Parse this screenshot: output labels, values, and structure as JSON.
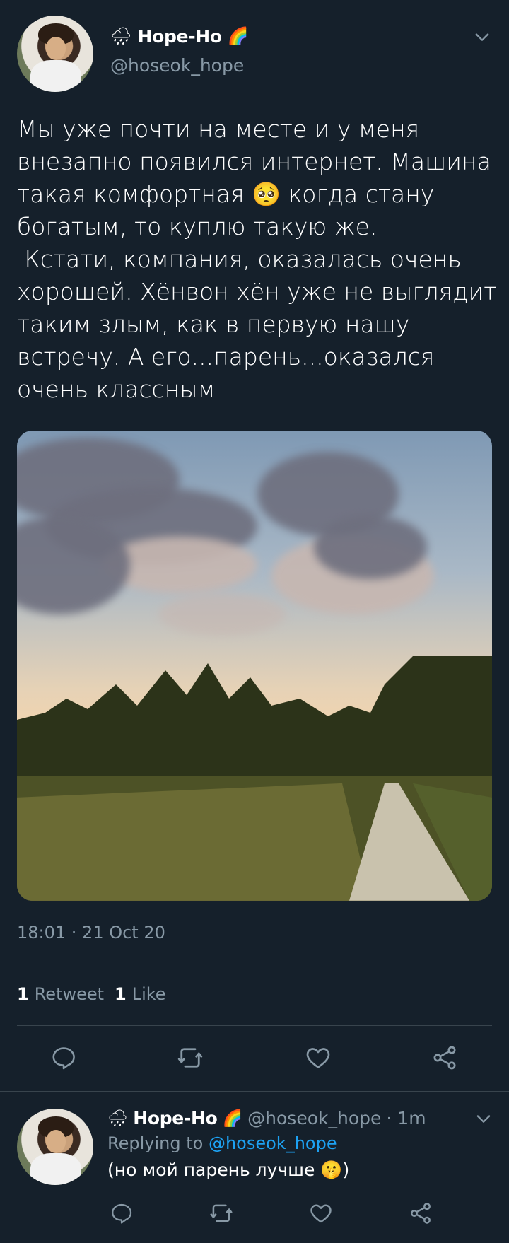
{
  "tweet": {
    "prefix_emoji": "🌧",
    "display_name": "Hope-Ho",
    "suffix_emoji": "🌈",
    "handle": "@hoseok_hope",
    "text": "Мы уже почти на месте и у меня внезапно появился интернет. Машина такая комфортная 🥺 когда стану богатым, то куплю такую же.\n Кстати, компания, оказалась очень хорошей. Хёнвон хён уже не выглядит таким злым, как в первую нашу встречу. А его...парень...оказался очень классным",
    "timestamp": "18:01 · 21 Oct 20",
    "retweets_count": "1",
    "retweets_label": "Retweet",
    "likes_count": "1",
    "likes_label": "Like"
  },
  "reply": {
    "prefix_emoji": "🌧",
    "display_name": "Hope-Ho",
    "suffix_emoji": "🌈",
    "handle": "@hoseok_hope",
    "time": "· 1m",
    "replying_prefix": "Replying to",
    "replying_handle": "@hoseok_hope",
    "text": "(но мой парень лучше 🤫)"
  },
  "icons": [
    "chevron-down-icon",
    "reply-icon",
    "retweet-icon",
    "like-icon",
    "share-icon"
  ],
  "colors": {
    "background": "#15202b",
    "muted": "#8899a6",
    "link": "#1da1f2",
    "divider": "#38444d"
  }
}
